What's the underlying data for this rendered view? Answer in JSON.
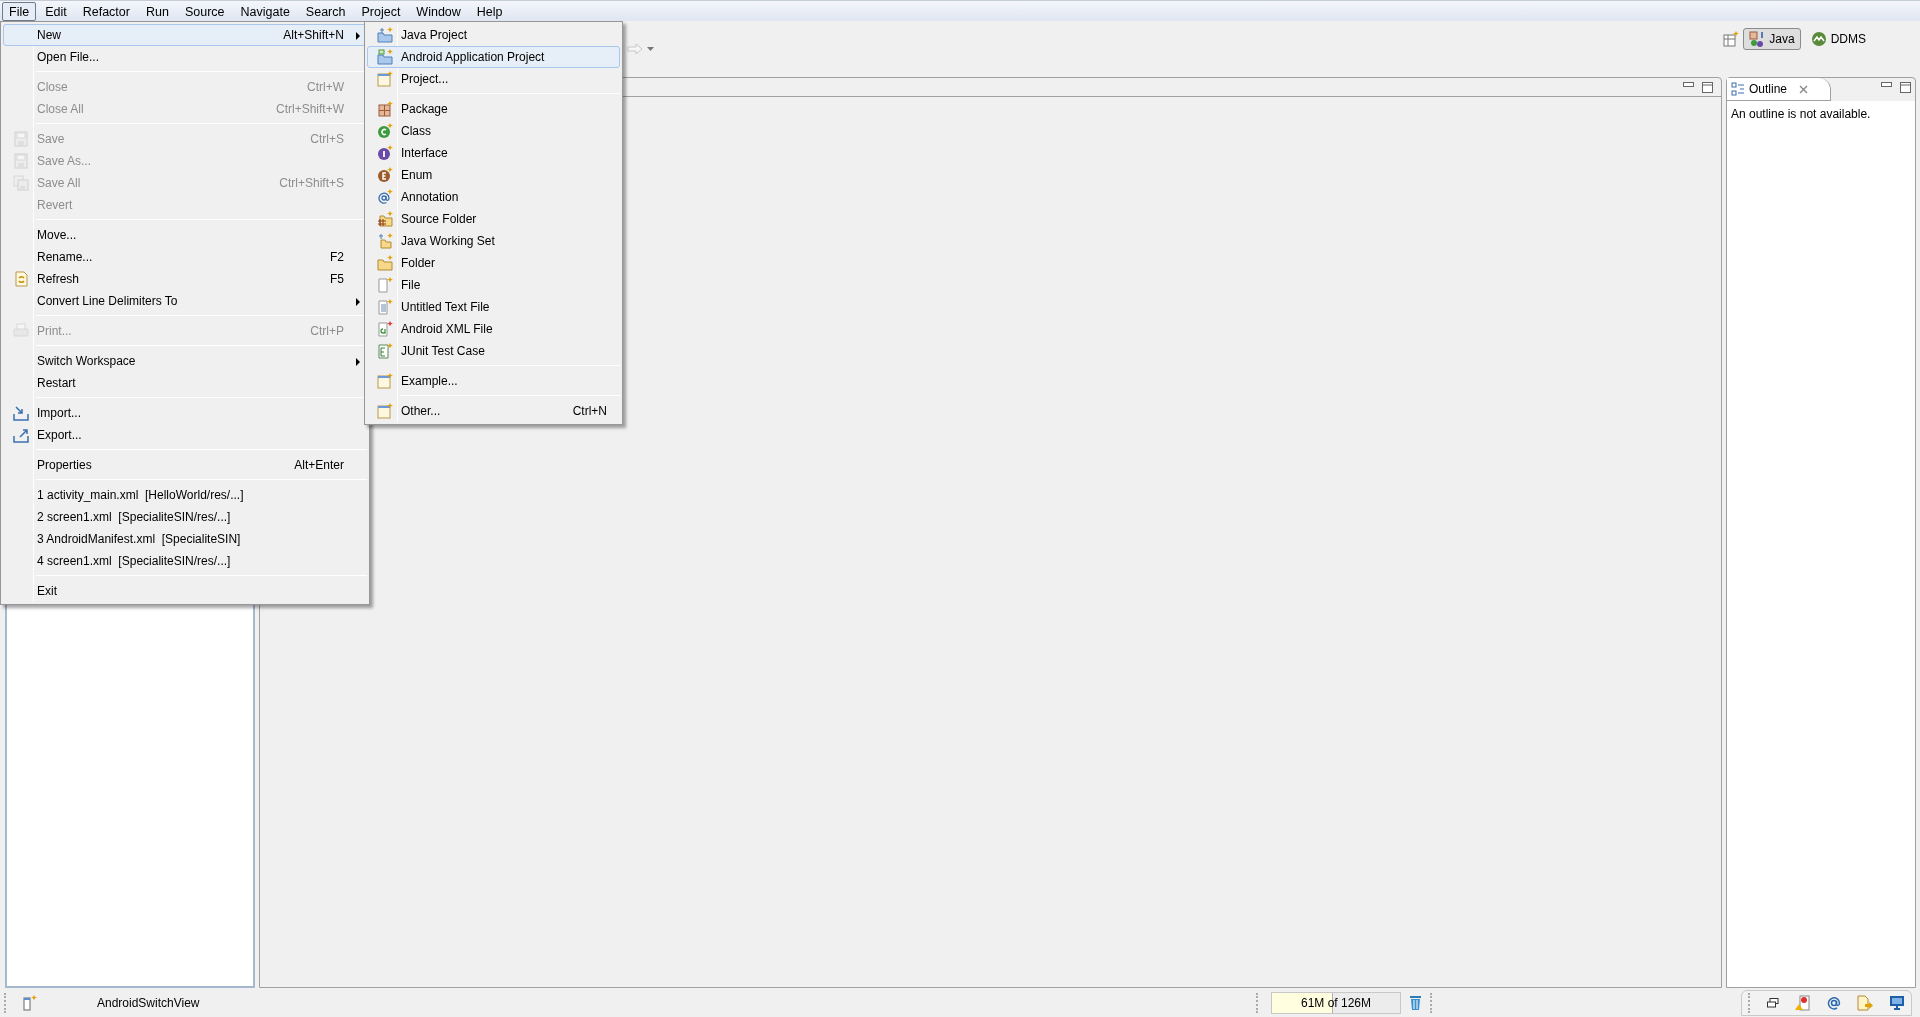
{
  "menu_bar": [
    {
      "label": "File",
      "selected": true
    },
    {
      "label": "Edit",
      "selected": false
    },
    {
      "label": "Refactor",
      "selected": false
    },
    {
      "label": "Run",
      "selected": false
    },
    {
      "label": "Source",
      "selected": false
    },
    {
      "label": "Navigate",
      "selected": false
    },
    {
      "label": "Search",
      "selected": false
    },
    {
      "label": "Project",
      "selected": false
    },
    {
      "label": "Window",
      "selected": false
    },
    {
      "label": "Help",
      "selected": false
    }
  ],
  "file_menu": [
    [
      {
        "label": "New",
        "shortcut": "Alt+Shift+N",
        "submenu": true,
        "disabled": false,
        "selected": true
      },
      {
        "label": "Open File...",
        "disabled": false,
        "selected": false
      }
    ],
    [
      {
        "label": "Close",
        "shortcut": "Ctrl+W",
        "disabled": true,
        "selected": false
      },
      {
        "label": "Close All",
        "shortcut": "Ctrl+Shift+W",
        "disabled": true,
        "selected": false
      }
    ],
    [
      {
        "label": "Save",
        "shortcut": "Ctrl+S",
        "disabled": true,
        "selected": false
      },
      {
        "label": "Save As...",
        "disabled": true,
        "selected": false
      },
      {
        "label": "Save All",
        "shortcut": "Ctrl+Shift+S",
        "disabled": true,
        "selected": false
      },
      {
        "label": "Revert",
        "disabled": true,
        "selected": false
      }
    ],
    [
      {
        "label": "Move...",
        "disabled": false,
        "selected": false
      },
      {
        "label": "Rename...",
        "shortcut": "F2",
        "disabled": false,
        "selected": false
      },
      {
        "label": "Refresh",
        "shortcut": "F5",
        "disabled": false,
        "selected": false
      },
      {
        "label": "Convert Line Delimiters To",
        "submenu": true,
        "disabled": false,
        "selected": false
      }
    ],
    [
      {
        "label": "Print...",
        "shortcut": "Ctrl+P",
        "disabled": true,
        "selected": false
      }
    ],
    [
      {
        "label": "Switch Workspace",
        "submenu": true,
        "disabled": false,
        "selected": false
      },
      {
        "label": "Restart",
        "disabled": false,
        "selected": false
      }
    ],
    [
      {
        "label": "Import...",
        "disabled": false,
        "selected": false
      },
      {
        "label": "Export...",
        "disabled": false,
        "selected": false
      }
    ],
    [
      {
        "label": "Properties",
        "shortcut": "Alt+Enter",
        "disabled": false,
        "selected": false
      }
    ],
    [
      {
        "label": "1 activity_main.xml  [HelloWorld/res/...]",
        "disabled": false,
        "selected": false
      },
      {
        "label": "2 screen1.xml  [SpecialiteSIN/res/...]",
        "disabled": false,
        "selected": false
      },
      {
        "label": "3 AndroidManifest.xml  [SpecialiteSIN]",
        "disabled": false,
        "selected": false
      },
      {
        "label": "4 screen1.xml  [SpecialiteSIN/res/...]",
        "disabled": false,
        "selected": false
      }
    ],
    [
      {
        "label": "Exit",
        "disabled": false,
        "selected": false
      }
    ]
  ],
  "new_submenu": [
    [
      {
        "label": "Java Project",
        "selected": false
      },
      {
        "label": "Android Application Project",
        "selected": true
      },
      {
        "label": "Project...",
        "selected": false
      }
    ],
    [
      {
        "label": "Package",
        "selected": false
      },
      {
        "label": "Class",
        "selected": false
      },
      {
        "label": "Interface",
        "selected": false
      },
      {
        "label": "Enum",
        "selected": false
      },
      {
        "label": "Annotation",
        "selected": false
      },
      {
        "label": "Source Folder",
        "selected": false
      },
      {
        "label": "Java Working Set",
        "selected": false
      },
      {
        "label": "Folder",
        "selected": false
      },
      {
        "label": "File",
        "selected": false
      },
      {
        "label": "Untitled Text File",
        "selected": false
      },
      {
        "label": "Android XML File",
        "selected": false
      },
      {
        "label": "JUnit Test Case",
        "selected": false
      }
    ],
    [
      {
        "label": "Example...",
        "selected": false
      }
    ],
    [
      {
        "label": "Other...",
        "shortcut": "Ctrl+N",
        "selected": false
      }
    ]
  ],
  "perspectives": [
    {
      "label": "Java",
      "selected": true
    },
    {
      "label": "DDMS",
      "selected": false
    }
  ],
  "outline": {
    "tab": "Outline",
    "message": "An outline is not available."
  },
  "status_bar": {
    "selection": "AndroidSwitchView",
    "memory": {
      "reading": "61M of 126M",
      "level": 0.48
    }
  }
}
